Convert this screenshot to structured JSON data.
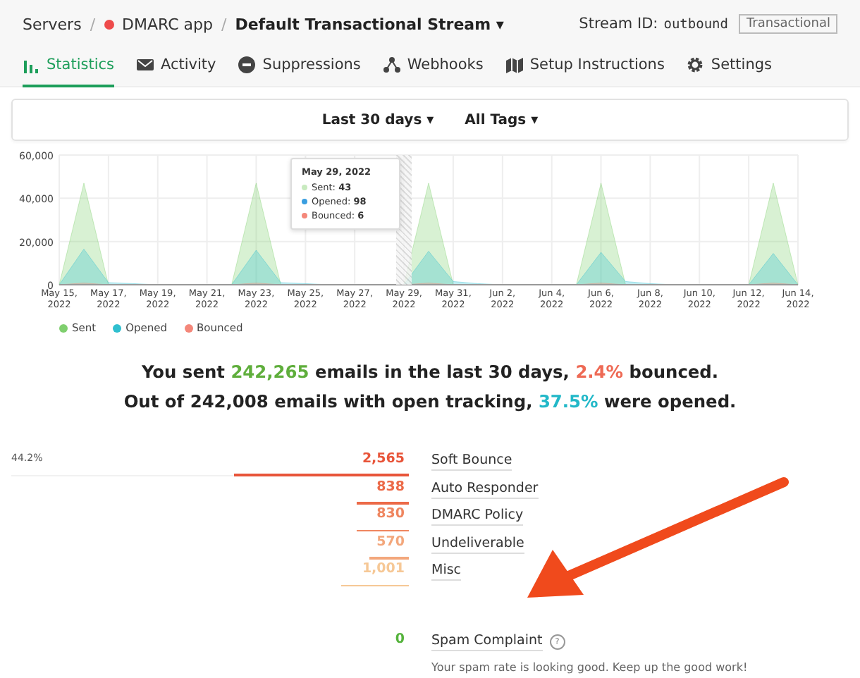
{
  "breadcrumbs": {
    "servers": "Servers",
    "separator": "/",
    "server": "DMARC app",
    "stream": "Default Transactional Stream",
    "caret": "▾"
  },
  "stream_info": {
    "label": "Stream ID:",
    "id": "outbound",
    "badge": "Transactional"
  },
  "tabs": [
    {
      "label": "Statistics",
      "kind": "bars",
      "selected": true
    },
    {
      "label": "Activity",
      "kind": "envelope",
      "selected": false
    },
    {
      "label": "Suppressions",
      "kind": "block",
      "selected": false
    },
    {
      "label": "Webhooks",
      "kind": "webhook",
      "selected": false
    },
    {
      "label": "Setup Instructions",
      "kind": "map",
      "selected": false
    },
    {
      "label": "Settings",
      "kind": "gear",
      "selected": false
    }
  ],
  "filters": [
    {
      "label": "Last 30 days",
      "caret": "▾"
    },
    {
      "label": "All Tags",
      "caret": "▾"
    }
  ],
  "chart": {
    "chart_data": {
      "type": "area",
      "categories": [
        "May 15, 2022",
        null,
        "May 17, 2022",
        null,
        "May 19, 2022",
        null,
        "May 21, 2022",
        null,
        "May 23, 2022",
        null,
        "May 25, 2022",
        null,
        "May 27, 2022",
        null,
        "May 29, 2022",
        null,
        "May 31, 2022",
        null,
        "Jun 2, 2022",
        null,
        "Jun 4, 2022",
        null,
        "Jun 6, 2022",
        null,
        "Jun 8, 2022",
        null,
        "Jun 10, 2022",
        null,
        "Jun 12, 2022",
        null,
        "Jun 14, 2022"
      ],
      "series": [
        {
          "name": "Sent",
          "color": "#7fcf6e",
          "values": [
            0,
            47000,
            0,
            0,
            0,
            0,
            0,
            0,
            47000,
            0,
            0,
            0,
            0,
            0,
            0,
            47000,
            0,
            0,
            0,
            0,
            0,
            0,
            47000,
            0,
            0,
            0,
            0,
            0,
            0,
            47000,
            0
          ]
        },
        {
          "name": "Opened",
          "color": "#2fbfcf",
          "values": [
            0,
            16500,
            1000,
            500,
            0,
            0,
            0,
            0,
            16000,
            1000,
            500,
            0,
            0,
            0,
            0,
            15500,
            1500,
            500,
            0,
            0,
            0,
            0,
            15000,
            1500,
            500,
            0,
            0,
            0,
            0,
            14500,
            0
          ]
        },
        {
          "name": "Bounced",
          "color": "#f4877a",
          "values": [
            0,
            800,
            0,
            0,
            0,
            0,
            0,
            0,
            800,
            0,
            0,
            0,
            0,
            0,
            0,
            800,
            0,
            0,
            0,
            0,
            0,
            0,
            800,
            0,
            0,
            0,
            0,
            0,
            0,
            800,
            0
          ]
        }
      ],
      "grid": true,
      "ylim": [
        0,
        60000
      ],
      "yticks": [
        {
          "value": 0,
          "label": "0"
        },
        {
          "value": 20000,
          "label": "20,000"
        },
        {
          "value": 40000,
          "label": "40,000"
        },
        {
          "value": 60000,
          "label": "60,000"
        }
      ]
    },
    "tooltip": {
      "title": "May 29, 2022",
      "lines": [
        {
          "text": "Sent: **43**",
          "color": "#c8eabf"
        },
        {
          "text": "Opened: **98**",
          "color": "#3a9ee0"
        },
        {
          "text": "Bounced: **6**",
          "color": "#f4877a"
        }
      ]
    }
  },
  "summary": [
    "You sent **242,265** emails in the last 30 days, **2.4%** bounced.",
    "Out of 242,008 emails with open tracking, **37.5%** were opened."
  ],
  "bounces": [
    {
      "count": "2,565",
      "label": "Soft Bounce",
      "level": 0.44,
      "percent": "44.2%",
      "color": "#e8553a"
    },
    {
      "count": "838",
      "label": "Auto Responder",
      "level": 0.13,
      "color": "#ec6a48"
    },
    {
      "count": "830",
      "label": "DMARC Policy",
      "level": 0.13,
      "color": "#ef8660"
    },
    {
      "count": "570",
      "label": "Undeliverable",
      "level": 0.1,
      "color": "#f3a77c"
    },
    {
      "count": "1,001",
      "label": "Misc",
      "level": 0.17,
      "color": "#f6c896"
    }
  ],
  "spam": {
    "count": "0",
    "label": "Spam Complaint",
    "help": "?",
    "message": "Your spam rate is looking good. Keep up the good work!"
  }
}
